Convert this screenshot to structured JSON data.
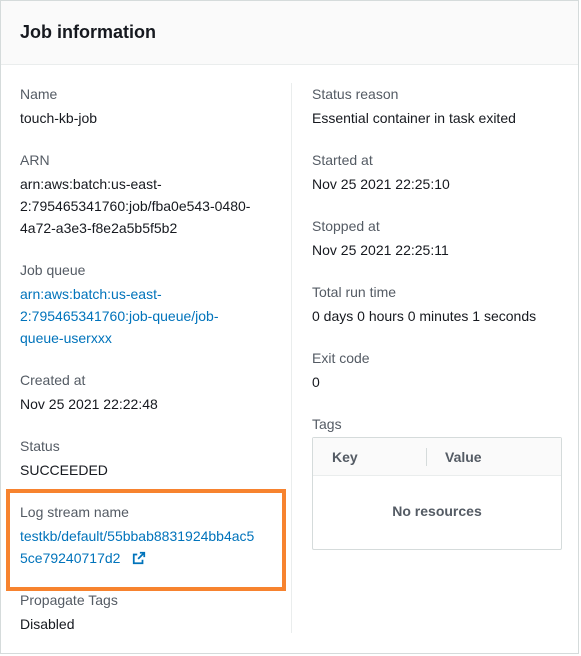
{
  "header": {
    "title": "Job information"
  },
  "left": {
    "name": {
      "label": "Name",
      "value": "touch-kb-job"
    },
    "arn": {
      "label": "ARN",
      "lines": [
        "arn:aws:batch:us-east-",
        "2:795465341760:job/fba0e543-0480-",
        "4a72-a3e3-f8e2a5b5f5b2"
      ]
    },
    "job_queue": {
      "label": "Job queue",
      "lines": [
        "arn:aws:batch:us-east-",
        "2:795465341760:job-queue/job-",
        "queue-userxxx"
      ]
    },
    "created_at": {
      "label": "Created at",
      "value": "Nov 25 2021 22:22:48"
    },
    "status": {
      "label": "Status",
      "value": "SUCCEEDED"
    },
    "log_stream": {
      "label": "Log stream name",
      "lines": [
        "testkb/default/55bbab8831924bb4ac5",
        "5ce79240717d2"
      ],
      "icon": "external-link-icon"
    },
    "propagate_tags": {
      "label": "Propagate Tags",
      "value": "Disabled"
    }
  },
  "right": {
    "status_reason": {
      "label": "Status reason",
      "value": "Essential container in task exited"
    },
    "started_at": {
      "label": "Started at",
      "value": "Nov 25 2021 22:25:10"
    },
    "stopped_at": {
      "label": "Stopped at",
      "value": "Nov 25 2021 22:25:11"
    },
    "total_run_time": {
      "label": "Total run time",
      "value": "0 days 0 hours 0 minutes 1 seconds"
    },
    "exit_code": {
      "label": "Exit code",
      "value": "0"
    },
    "tags": {
      "label": "Tags",
      "columns": [
        "Key",
        "Value"
      ],
      "empty_text": "No resources"
    }
  },
  "colors": {
    "link": "#0073bb",
    "highlight": "#f7832f",
    "label": "#545b64",
    "text": "#16191f"
  }
}
